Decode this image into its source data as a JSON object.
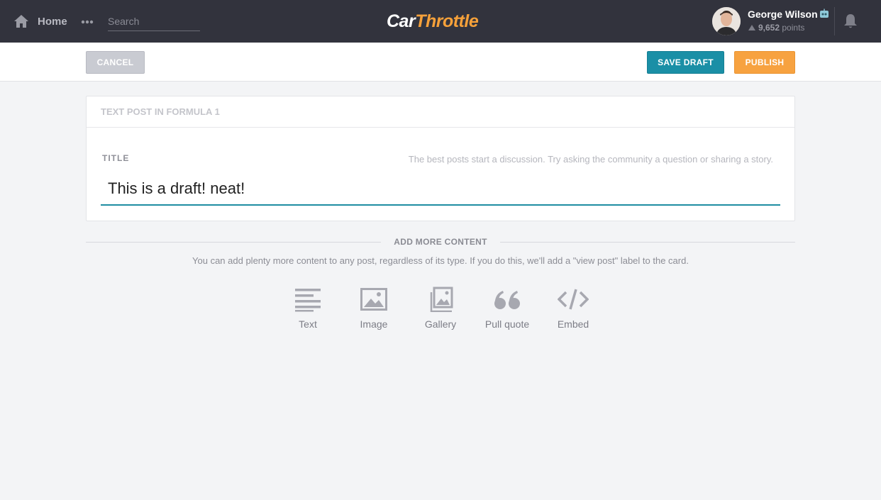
{
  "nav": {
    "home_label": "Home",
    "search_placeholder": "Search",
    "logo_part1": "Car",
    "logo_part2": "Throttle",
    "user_name": "George Wilson",
    "points_value": "9,652",
    "points_label": "points"
  },
  "actions": {
    "cancel_label": "CANCEL",
    "save_draft_label": "SAVE DRAFT",
    "publish_label": "PUBLISH"
  },
  "post": {
    "header": "TEXT POST IN FORMULA 1",
    "title_label": "TITLE",
    "title_hint": "The best posts start a discussion. Try asking the community a question or sharing a story.",
    "title_value": "This is a draft! neat!"
  },
  "add_more": {
    "title": "ADD MORE CONTENT",
    "description": "You can add plenty more content to any post, regardless of its type. If you do this, we'll add a \"view post\" label to the card.",
    "tools": [
      {
        "label": "Text",
        "icon": "text-lines-icon"
      },
      {
        "label": "Image",
        "icon": "image-icon"
      },
      {
        "label": "Gallery",
        "icon": "gallery-icon"
      },
      {
        "label": "Pull quote",
        "icon": "quote-icon"
      },
      {
        "label": "Embed",
        "icon": "code-icon"
      }
    ]
  },
  "colors": {
    "topbar": "#32333d",
    "accent_teal": "#1a8fa6",
    "accent_orange": "#f7a240",
    "background": "#f3f4f6"
  }
}
